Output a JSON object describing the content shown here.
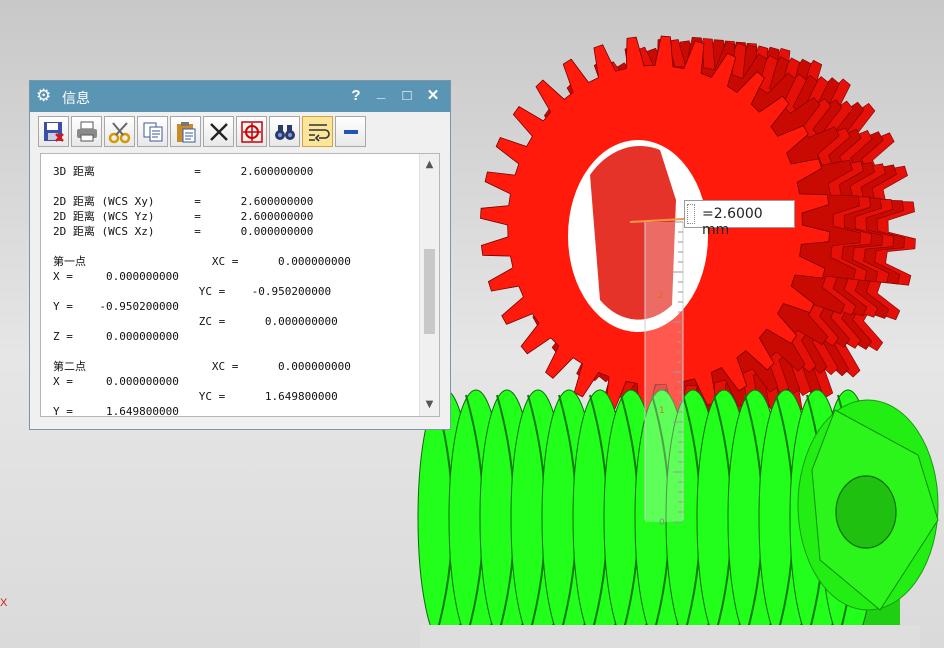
{
  "viewport": {
    "axis_label": "X",
    "dimension_value": "=2.6000 mm",
    "ruler_labels": [
      "2",
      "1",
      "0"
    ],
    "colors": {
      "gear": "#ff1a0c",
      "worm": "#22ff1a",
      "background": "#d8d8d8"
    }
  },
  "info_window": {
    "title": "信息",
    "icon": "gear-icon",
    "controls": {
      "help": "?",
      "minimize": "_",
      "maximize": "□",
      "close": "✕"
    },
    "toolbar": [
      {
        "name": "save-icon"
      },
      {
        "name": "print-icon"
      },
      {
        "name": "cut-icon"
      },
      {
        "name": "copy-icon"
      },
      {
        "name": "paste-icon"
      },
      {
        "name": "clear-icon"
      },
      {
        "name": "target-icon"
      },
      {
        "name": "binoculars-icon"
      },
      {
        "name": "word-wrap-icon",
        "active": true
      },
      {
        "name": "minus-icon"
      }
    ],
    "lines": [
      "3D 距离               =      2.600000000",
      "",
      "2D 距离 (WCS Xy)      =      2.600000000",
      "2D 距离 (WCS Yz)      =      2.600000000",
      "2D 距离 (WCS Xz)      =      0.000000000",
      "",
      "第一点                   XC =      0.000000000",
      "X =     0.000000000",
      "                      YC =    -0.950200000",
      "Y =    -0.950200000",
      "                      ZC =      0.000000000",
      "Z =     0.000000000",
      "",
      "第二点                   XC =      0.000000000",
      "X =     0.000000000",
      "                      YC =      1.649800000",
      "Y =     1.649800000"
    ]
  }
}
